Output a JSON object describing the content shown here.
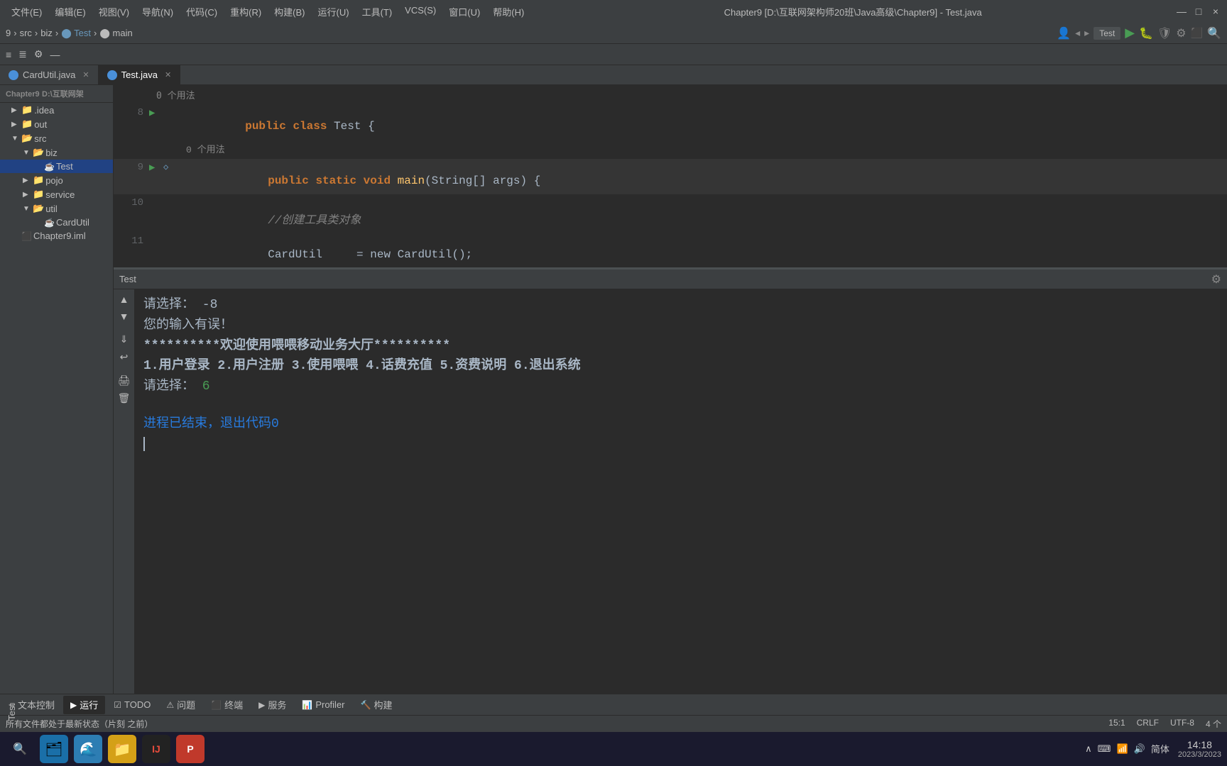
{
  "titlebar": {
    "menus": [
      "文件(E)",
      "编辑(E)",
      "视图(V)",
      "导航(N)",
      "代码(C)",
      "重构(R)",
      "构建(B)",
      "运行(U)",
      "工具(T)",
      "VCS(S)",
      "窗口(U)",
      "帮助(H)"
    ],
    "title": "Chapter9 [D:\\互联网架构师20班\\Java高级\\Chapter9] - Test.java",
    "controls": [
      "—",
      "□",
      "×"
    ]
  },
  "navbar": {
    "breadcrumb": [
      "9",
      "src",
      "biz",
      "Test",
      "main"
    ],
    "run_config": "Test",
    "buttons": [
      "◂",
      "▸",
      "▶",
      "⏸",
      "⏹",
      "🔧",
      "⚙",
      "🔍"
    ]
  },
  "toolbar": {
    "buttons": [
      "≡",
      "≡",
      "⚙",
      "—"
    ]
  },
  "tabs": [
    {
      "name": "CardUtil.java",
      "active": false
    },
    {
      "name": "Test.java",
      "active": true
    }
  ],
  "sidebar": {
    "header": "Chapter9",
    "header_path": "D:\\互联网架",
    "items": [
      {
        "label": ".idea",
        "indent": 1,
        "type": "folder",
        "expanded": false
      },
      {
        "label": "out",
        "indent": 1,
        "type": "folder",
        "expanded": false
      },
      {
        "label": "src",
        "indent": 1,
        "type": "folder",
        "expanded": true
      },
      {
        "label": "biz",
        "indent": 2,
        "type": "folder",
        "expanded": true
      },
      {
        "label": "Test",
        "indent": 3,
        "type": "file",
        "selected": true
      },
      {
        "label": "pojo",
        "indent": 2,
        "type": "folder",
        "expanded": false
      },
      {
        "label": "service",
        "indent": 2,
        "type": "folder",
        "expanded": false
      },
      {
        "label": "util",
        "indent": 2,
        "type": "folder",
        "expanded": true
      },
      {
        "label": "CardUtil",
        "indent": 3,
        "type": "file"
      },
      {
        "label": "Chapter9.iml",
        "indent": 1,
        "type": "file-iml"
      }
    ]
  },
  "editor": {
    "usage_top": "0 个用法",
    "lines": [
      {
        "num": "8",
        "has_run": true,
        "content_html": "<span class='kw-public'>public</span> <span class='kw-class'>class</span> Test {",
        "highlighted": false
      },
      {
        "num": "",
        "has_run": false,
        "content_html": "    0 个用法",
        "is_usage": true,
        "highlighted": false
      },
      {
        "num": "9",
        "has_run": true,
        "content_html": "    <span class='kw-public'>public</span> <span class='kw-static'>static</span> <span class='kw-void'>void</span> main(String[] args) {",
        "highlighted": true,
        "has_bookmark": true
      },
      {
        "num": "10",
        "has_run": false,
        "content_html": "        <span class='comment'>//创建工具类对象</span>",
        "highlighted": false
      },
      {
        "num": "11",
        "has_run": false,
        "content_html": "        CardUtil     = new CardUtil();",
        "highlighted": false,
        "truncated": true
      }
    ]
  },
  "console": {
    "title": "Test",
    "output_lines": [
      {
        "text": "请选择：  -8",
        "type": "prompt"
      },
      {
        "text": "您的输入有误！",
        "type": "error"
      },
      {
        "text": "**********欢迎使用喂喂移动业务大厅**********",
        "type": "highlight"
      },
      {
        "text": "1.用户登录  2.用户注册  3.使用喂喂  4.话费充值  5.资费说明  6.退出系统",
        "type": "menu"
      },
      {
        "text_prefix": "请选择：",
        "text_value": " 6",
        "type": "choice"
      },
      {
        "text": "",
        "type": "blank"
      },
      {
        "text": "进程已结束，退出代码0",
        "type": "exit"
      }
    ]
  },
  "bottom_tabs": [
    {
      "label": "文本控制",
      "icon": "≡"
    },
    {
      "label": "运行",
      "icon": "▶",
      "active": true
    },
    {
      "label": "TODO",
      "icon": "☑"
    },
    {
      "label": "问题",
      "icon": "⚠"
    },
    {
      "label": "终端",
      "icon": "⬛"
    },
    {
      "label": "服务",
      "icon": "▶"
    },
    {
      "label": "Profiler",
      "icon": "📊"
    },
    {
      "label": "构建",
      "icon": "🔨"
    }
  ],
  "statusbar": {
    "left": "所有文件都处于最新状态（片刻 之前）",
    "position": "15:1",
    "line_sep": "CRLF",
    "encoding": "UTF-8",
    "indent": "4 个"
  },
  "taskbar": {
    "time": "14:18",
    "date": "2023/3/2023",
    "lang": "简体"
  }
}
